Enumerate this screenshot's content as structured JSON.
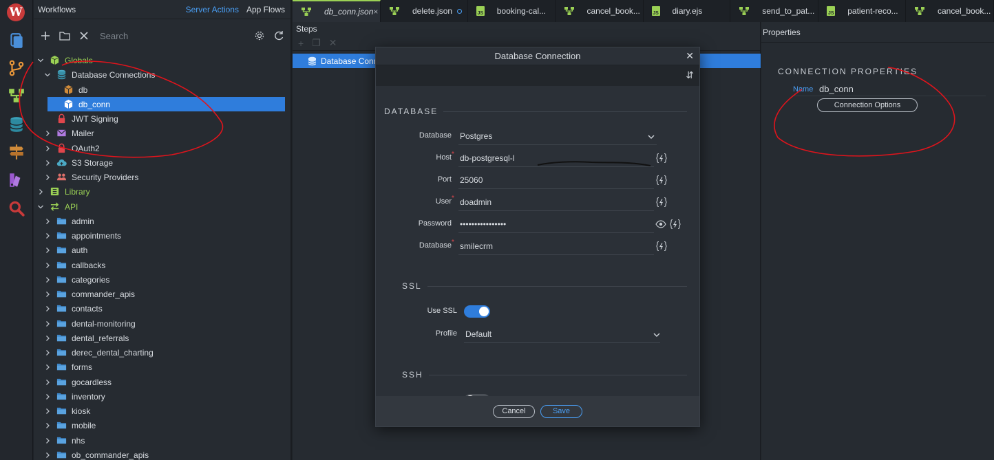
{
  "activity": {
    "icons": [
      "wappler-logo-icon",
      "pages-icon",
      "git-icon",
      "workflows-icon",
      "database-icon",
      "routing-icon",
      "design-icon",
      "search-icon"
    ]
  },
  "workflows_panel": {
    "title": "Workflows",
    "server_actions": "Server Actions",
    "app_flows": "App Flows",
    "search_placeholder": "Search"
  },
  "tree": [
    {
      "label": "Globals",
      "level": 0,
      "expanded": true,
      "icon": "globals-cube-icon",
      "color": "#9bd155"
    },
    {
      "label": "Database Connections",
      "level": 1,
      "expanded": true,
      "icon": "database-stack-icon"
    },
    {
      "label": "db",
      "level": 2,
      "icon": "db-cube-icon"
    },
    {
      "label": "db_conn",
      "level": 2,
      "icon": "db-cube-icon",
      "selected": true
    },
    {
      "label": "JWT Signing",
      "level": 1,
      "icon": "lock-icon"
    },
    {
      "label": "Mailer",
      "level": 1,
      "collapsed": true,
      "icon": "mail-icon"
    },
    {
      "label": "OAuth2",
      "level": 1,
      "collapsed": true,
      "icon": "lock-icon"
    },
    {
      "label": "S3 Storage",
      "level": 1,
      "collapsed": true,
      "icon": "cloud-icon"
    },
    {
      "label": "Security Providers",
      "level": 1,
      "collapsed": true,
      "icon": "users-icon"
    },
    {
      "label": "Library",
      "level": 0,
      "collapsed": true,
      "icon": "library-icon",
      "color": "#9bd155"
    },
    {
      "label": "API",
      "level": 0,
      "expanded": true,
      "icon": "api-arrows-icon",
      "color": "#9bd155"
    },
    {
      "label": "admin",
      "level": 1,
      "collapsed": true,
      "icon": "folder-icon"
    },
    {
      "label": "appointments",
      "level": 1,
      "collapsed": true,
      "icon": "folder-icon"
    },
    {
      "label": "auth",
      "level": 1,
      "collapsed": true,
      "icon": "folder-icon"
    },
    {
      "label": "callbacks",
      "level": 1,
      "collapsed": true,
      "icon": "folder-icon"
    },
    {
      "label": "categories",
      "level": 1,
      "collapsed": true,
      "icon": "folder-icon"
    },
    {
      "label": "commander_apis",
      "level": 1,
      "collapsed": true,
      "icon": "folder-icon"
    },
    {
      "label": "contacts",
      "level": 1,
      "collapsed": true,
      "icon": "folder-icon"
    },
    {
      "label": "dental-monitoring",
      "level": 1,
      "collapsed": true,
      "icon": "folder-icon"
    },
    {
      "label": "dental_referrals",
      "level": 1,
      "collapsed": true,
      "icon": "folder-icon"
    },
    {
      "label": "derec_dental_charting",
      "level": 1,
      "collapsed": true,
      "icon": "folder-icon"
    },
    {
      "label": "forms",
      "level": 1,
      "collapsed": true,
      "icon": "folder-icon"
    },
    {
      "label": "gocardless",
      "level": 1,
      "collapsed": true,
      "icon": "folder-icon"
    },
    {
      "label": "inventory",
      "level": 1,
      "collapsed": true,
      "icon": "folder-icon"
    },
    {
      "label": "kiosk",
      "level": 1,
      "collapsed": true,
      "icon": "folder-icon"
    },
    {
      "label": "mobile",
      "level": 1,
      "collapsed": true,
      "icon": "folder-icon"
    },
    {
      "label": "nhs",
      "level": 1,
      "collapsed": true,
      "icon": "folder-icon"
    },
    {
      "label": "ob_commander_apis",
      "level": 1,
      "collapsed": true,
      "icon": "folder-icon"
    }
  ],
  "tabs": [
    {
      "label": "db_conn.json",
      "type": "flow",
      "active": true,
      "close": "×"
    },
    {
      "label": "delete.json",
      "type": "flow",
      "modified": true
    },
    {
      "label": "booking-cal...",
      "type": "js"
    },
    {
      "label": "cancel_book...",
      "type": "flow"
    },
    {
      "label": "diary.ejs",
      "type": "js"
    },
    {
      "label": "send_to_pat...",
      "type": "flow"
    },
    {
      "label": "patient-reco...",
      "type": "js"
    },
    {
      "label": "cancel_book...",
      "type": "flow"
    }
  ],
  "steps": {
    "title": "Steps",
    "selected_step": "Database Conne"
  },
  "properties": {
    "title": "Properties",
    "section": "CONNECTION PROPERTIES",
    "name_label": "Name",
    "name_value": "db_conn",
    "options_button": "Connection Options"
  },
  "modal": {
    "title": "Database Connection",
    "database_section": "DATABASE",
    "fields": [
      {
        "label": "Database",
        "value": "Postgres",
        "type": "select"
      },
      {
        "label": "Host",
        "value": "db-postgresql-l",
        "required": true
      },
      {
        "label": "Port",
        "value": "25060"
      },
      {
        "label": "User",
        "value": "doadmin",
        "required": true
      },
      {
        "label": "Password",
        "value": "••••••••••••••••",
        "type": "password"
      },
      {
        "label": "Database",
        "value": "smilecrm",
        "required": true
      }
    ],
    "ssl_section": "SSL",
    "use_ssl_label": "Use SSL",
    "use_ssl": true,
    "profile_label": "Profile",
    "profile_value": "Default",
    "ssh_section": "SSH",
    "use_ssh": false,
    "cancel": "Cancel",
    "save": "Save",
    "required_mark": "*"
  },
  "colors": {
    "accent": "#2f7ddc",
    "link": "#4a9ff5",
    "green": "#9bd155",
    "annotation_red": "#e0141c"
  }
}
